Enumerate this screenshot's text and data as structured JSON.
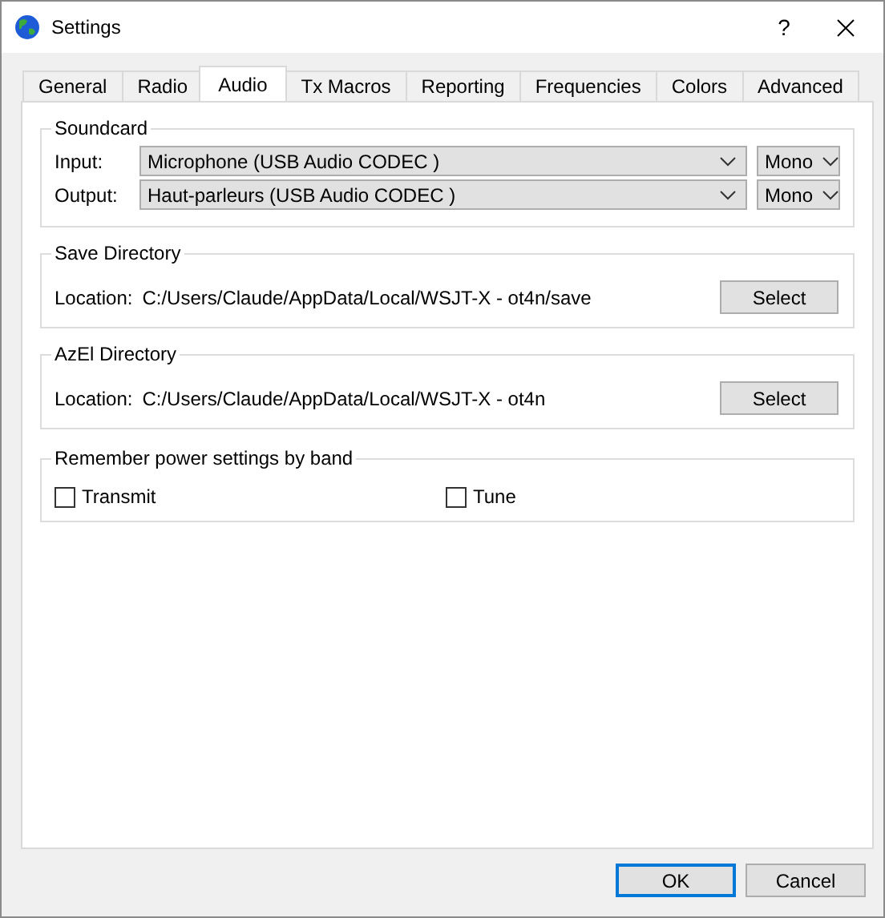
{
  "window": {
    "title": "Settings",
    "help": "?"
  },
  "tabs": [
    {
      "label": "General",
      "selected": false
    },
    {
      "label": "Radio",
      "selected": false
    },
    {
      "label": "Audio",
      "selected": true
    },
    {
      "label": "Tx Macros",
      "selected": false
    },
    {
      "label": "Reporting",
      "selected": false
    },
    {
      "label": "Frequencies",
      "selected": false
    },
    {
      "label": "Colors",
      "selected": false
    },
    {
      "label": "Advanced",
      "selected": false
    }
  ],
  "soundcard": {
    "title": "Soundcard",
    "rows": [
      {
        "label": "Input:",
        "device": "Microphone (USB Audio CODEC )",
        "channel": "Mono"
      },
      {
        "label": "Output:",
        "device": "Haut-parleurs (USB Audio CODEC )",
        "channel": "Mono"
      }
    ]
  },
  "directories": [
    {
      "title": "Save Directory",
      "label": "Location:",
      "path": "C:/Users/Claude/AppData/Local/WSJT-X - ot4n/save",
      "button": "Select"
    },
    {
      "title": "AzEl Directory",
      "label": "Location:",
      "path": "C:/Users/Claude/AppData/Local/WSJT-X - ot4n",
      "button": "Select"
    }
  ],
  "power": {
    "title": "Remember power settings by band",
    "options": [
      {
        "label": "Transmit",
        "checked": false
      },
      {
        "label": "Tune",
        "checked": false
      }
    ]
  },
  "buttons": [
    {
      "label": "OK",
      "default": true
    },
    {
      "label": "Cancel",
      "default": false
    }
  ]
}
